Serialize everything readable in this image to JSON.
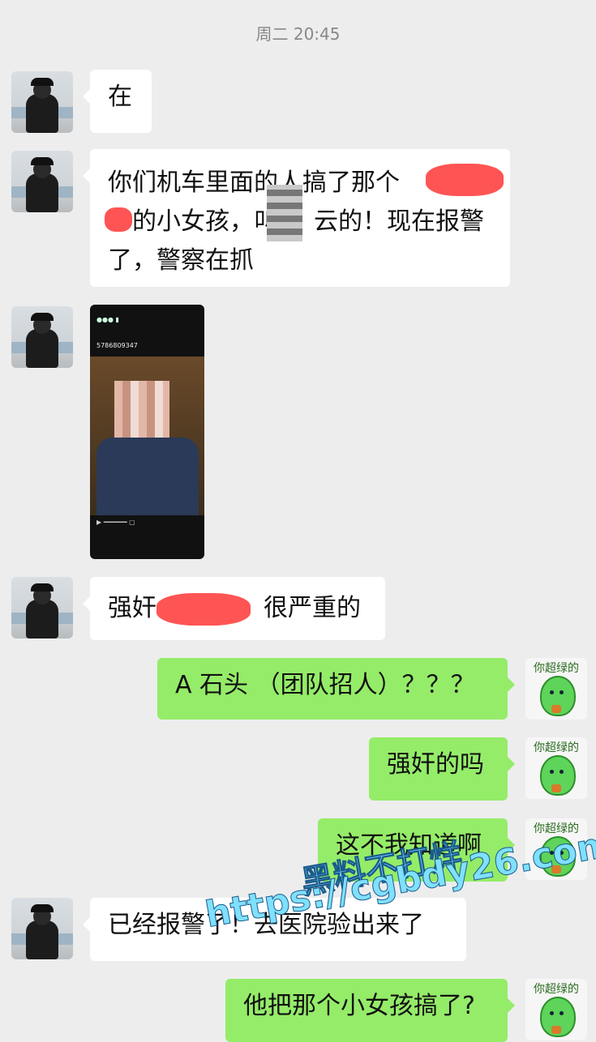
{
  "header": {
    "timestamp": "周二 20:45"
  },
  "messages": [
    {
      "side": "left",
      "text": "在"
    },
    {
      "side": "left",
      "lines": [
        "你们机车里面的人搞了那个",
        "的小女孩，叫",
        "云的！现在报警",
        "了，警察在抓"
      ]
    },
    {
      "side": "left",
      "type": "image",
      "caption_small": "5786809347"
    },
    {
      "side": "left",
      "parts": [
        "强奸",
        "很严重的"
      ]
    },
    {
      "side": "right",
      "text": "A 石头 （团队招人）？？？"
    },
    {
      "side": "right",
      "text": "强奸的吗"
    },
    {
      "side": "right",
      "text": "这不我知道啊"
    },
    {
      "side": "left",
      "text": "已经报警了！去医院验出来了"
    },
    {
      "side": "right",
      "text": "他把那个小女孩搞了?"
    }
  ],
  "self_avatar": {
    "caption": "你超绿的"
  },
  "watermark": {
    "line1": "黑料不打烊",
    "line2": "https://cgbdy26.com"
  },
  "colors": {
    "background": "#ededed",
    "left_bubble": "#ffffff",
    "right_bubble": "#95ec69",
    "redaction": "#ff4b4b"
  }
}
